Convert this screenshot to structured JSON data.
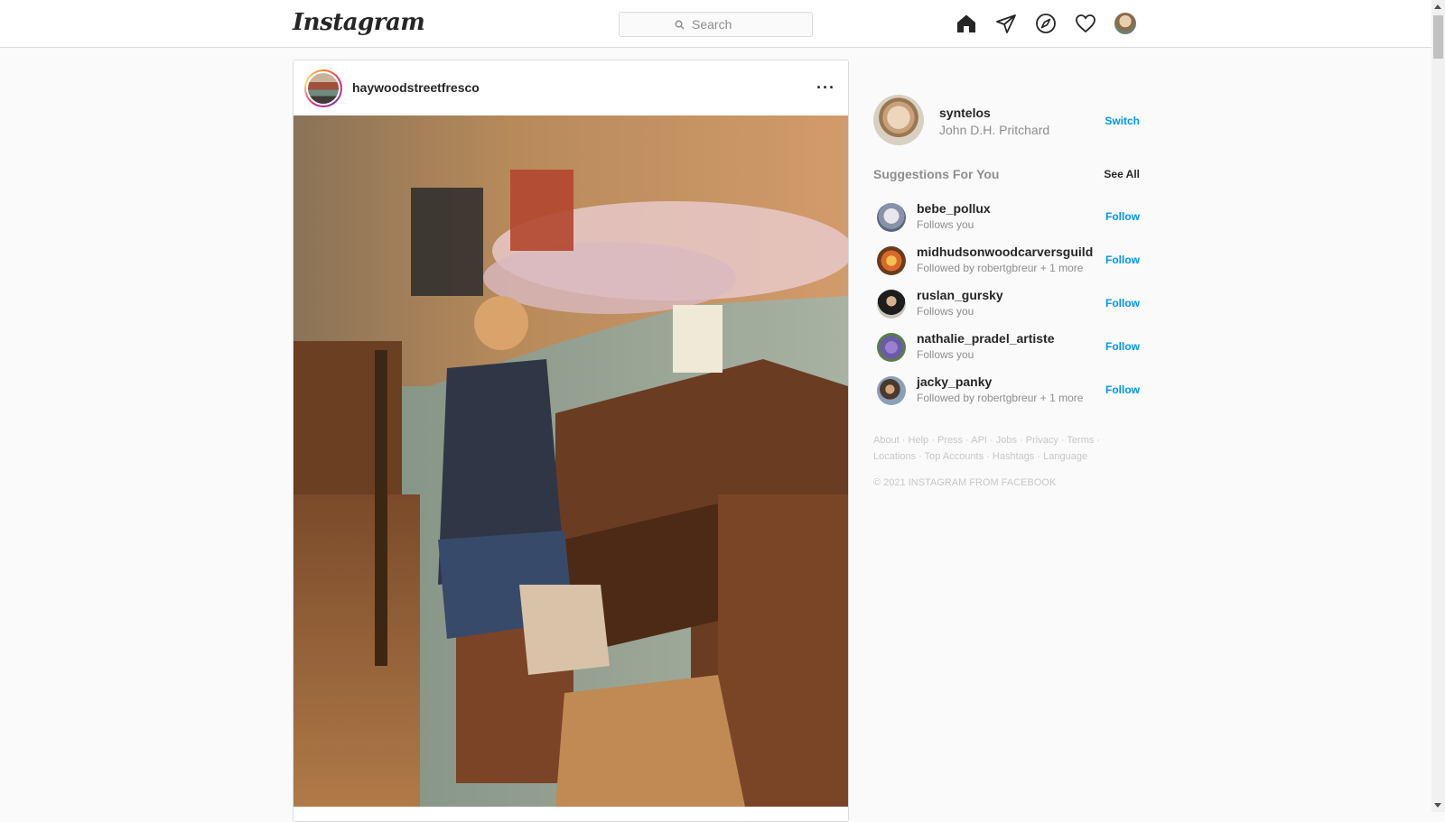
{
  "header": {
    "logo": "Instagram",
    "search_placeholder": "Search",
    "nav": [
      "home-icon",
      "direct-icon",
      "explore-icon",
      "activity-icon",
      "profile-avatar"
    ]
  },
  "post": {
    "username": "haywoodstreetfresco",
    "more_label": "···"
  },
  "sidebar": {
    "me": {
      "username": "syntelos",
      "full_name": "John D.H. Pritchard",
      "switch_label": "Switch"
    },
    "suggestions_title": "Suggestions For You",
    "see_all": "See All",
    "suggestions": [
      {
        "username": "bebe_pollux",
        "sub": "Follows you",
        "action": "Follow"
      },
      {
        "username": "midhudsonwoodcarversguild",
        "sub": "Followed by robertgbreur + 1 more",
        "action": "Follow"
      },
      {
        "username": "ruslan_gursky",
        "sub": "Follows you",
        "action": "Follow"
      },
      {
        "username": "nathalie_pradel_artiste",
        "sub": "Follows you",
        "action": "Follow"
      },
      {
        "username": "jacky_panky",
        "sub": "Followed by robertgbreur + 1 more",
        "action": "Follow"
      }
    ],
    "footer_links": [
      "About",
      "Help",
      "Press",
      "API",
      "Jobs",
      "Privacy",
      "Terms",
      "Locations",
      "Top Accounts",
      "Hashtags",
      "Language"
    ],
    "copyright": "© 2021 INSTAGRAM FROM FACEBOOK"
  },
  "colors": {
    "accent": "#0095f6",
    "muted": "#8e8e8e",
    "border": "#dbdbdb"
  }
}
